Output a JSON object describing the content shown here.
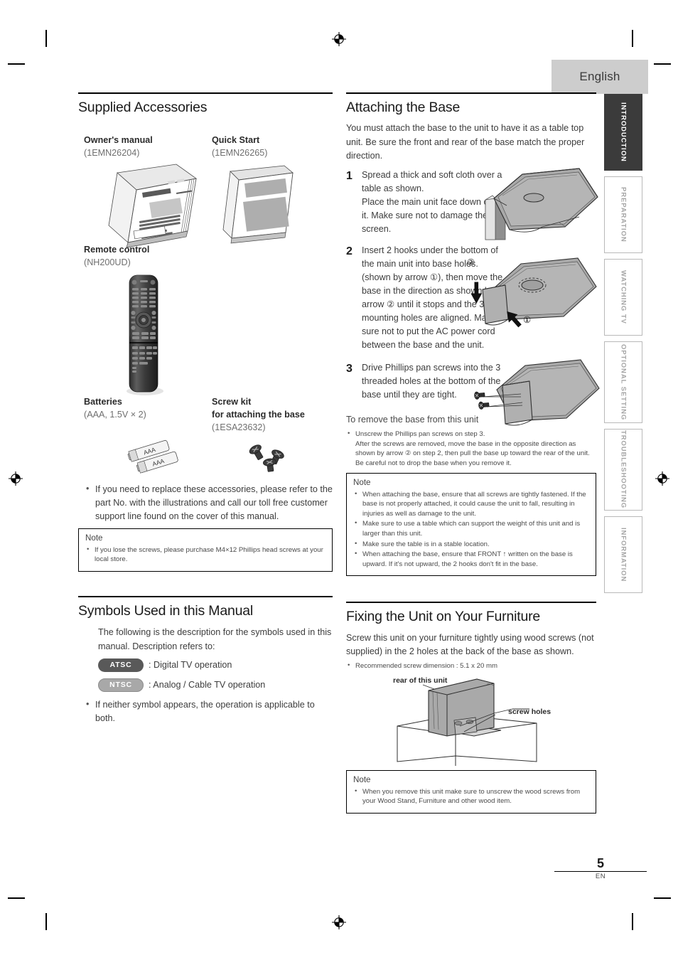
{
  "header": {
    "language_tab": "English"
  },
  "side_tabs": [
    {
      "label": "INTRODUCTION",
      "active": true
    },
    {
      "label": "PREPARATION",
      "active": false
    },
    {
      "label": "WATCHING TV",
      "active": false
    },
    {
      "label": "OPTIONAL SETTING",
      "active": false
    },
    {
      "label": "TROUBLESHOOTING",
      "active": false
    },
    {
      "label": "INFORMATION",
      "active": false
    }
  ],
  "left_column": {
    "supplied_accessories": {
      "heading": "Supplied Accessories",
      "items": [
        {
          "name": "Owner's manual",
          "code": "(1EMN26204)"
        },
        {
          "name": "Quick Start",
          "code": "(1EMN26265)"
        },
        {
          "name": "Remote control",
          "code": "(NH200UD)"
        },
        {
          "name": "Batteries",
          "code": "(AAA, 1.5V × 2)"
        },
        {
          "name": "Screw kit",
          "name2": "for attaching the base",
          "code": "(1ESA23632)"
        }
      ],
      "bullets": [
        "If you need to replace these accessories, please refer to the part No. with the illustrations and call our toll free customer support line found on the cover of this manual."
      ],
      "note": {
        "title": "Note",
        "bullets": [
          "If you lose the screws, please purchase M4×12 Phillips head screws at your local store."
        ]
      },
      "battery_label": "AAA"
    },
    "symbols": {
      "heading": "Symbols Used in this Manual",
      "intro": "The following is the description for the symbols used in this manual. Description refers to:",
      "rows": [
        {
          "badge": "ATSC",
          "text": ": Digital TV operation"
        },
        {
          "badge": "NTSC",
          "text": ": Analog / Cable TV operation"
        }
      ],
      "bullets": [
        "If neither symbol appears, the operation is applicable to both."
      ]
    }
  },
  "right_column": {
    "attaching_base": {
      "heading": "Attaching the Base",
      "intro": "You must attach the base to the unit to have it as a table top unit. Be sure the front and rear of the base match the proper direction.",
      "steps": [
        {
          "num": "1",
          "text": "Spread a thick and soft cloth over a table as shown.\nPlace the main unit face down onto it. Make sure not to damage the screen."
        },
        {
          "num": "2",
          "text": "Insert 2 hooks under the bottom of the main unit into base holes. (shown by arrow ①), then move the base in the direction as shown by arrow ② until it stops and the 3 mounting holes are aligned. Make sure not to put the AC power cord between the base and the unit."
        },
        {
          "num": "3",
          "text": "Drive Phillips pan screws into the 3 threaded holes at the bottom of the base until they are tight."
        }
      ],
      "arrow_labels": {
        "one": "①",
        "two": "②"
      },
      "remove_title": "To remove the base from this unit",
      "remove_bullets": [
        "Unscrew the Phillips pan screws on step 3.\nAfter the screws are removed, move the base in the opposite direction as shown by arrow ② on step 2, then pull the base up toward the rear of the unit. Be careful not to drop the base when you remove it."
      ],
      "note": {
        "title": "Note",
        "bullets": [
          "When attaching the base, ensure that all screws are tightly fastened. If the base is not properly attached, it could cause the unit to fall, resulting in injuries as well as damage to the unit.",
          "Make sure to use a table which can support the weight of this unit and is larger than this unit.",
          "Make sure the table is in a stable location.",
          "When attaching the base, ensure that FRONT ↑ written on the base is upward. If it's not upward, the 2 hooks don't fit in the base."
        ]
      }
    },
    "fixing_unit": {
      "heading": "Fixing the Unit on Your Furniture",
      "intro": "Screw this unit on your furniture tightly using wood screws (not supplied) in the 2 holes at the back of the base as shown.",
      "bullets": [
        "Recommended screw dimension : 5.1 x 20 mm"
      ],
      "diagram_labels": {
        "rear": "rear of this unit",
        "screw_holes": "screw holes"
      },
      "note": {
        "title": "Note",
        "bullets": [
          "When you remove this unit make sure to unscrew the wood screws from your Wood Stand, Furniture and other wood item."
        ]
      }
    }
  },
  "footer": {
    "page_number": "5",
    "language_code": "EN"
  }
}
